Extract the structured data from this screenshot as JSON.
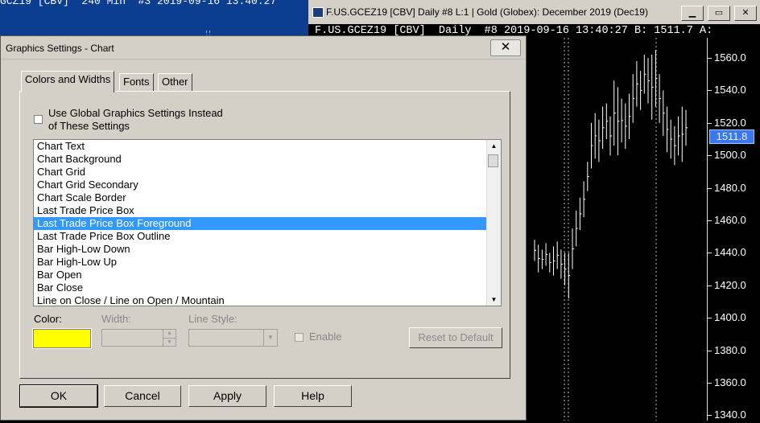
{
  "bg_window": {
    "header": "GCZ19 [CBV]  240 Min  #3 2019-09-16 13:40:27"
  },
  "chart_window": {
    "title": "F.US.GCEZ19 [CBV]  Daily  #8  L:1 | Gold (Globex): December 2019 (Dec19)",
    "info_bar": "F.US.GCEZ19 [CBV]  Daily  #8 2019-09-16 13:40:27 B: 1511.7 A:",
    "price_scale": [
      "1560.0",
      "1540.0",
      "1520.0",
      "1500.0",
      "1480.0",
      "1460.0",
      "1440.0",
      "1420.0",
      "1400.0",
      "1380.0",
      "1360.0",
      "1340.0"
    ],
    "last_price_box": "1511.8",
    "buttons": {
      "minimize": "▁",
      "restore": "▭",
      "close": "✕"
    },
    "colors": {
      "price_box": "#3a78f0",
      "background": "#000000"
    }
  },
  "dialog": {
    "title": "Graphics Settings  - Chart",
    "close_glyph": "✕",
    "tabs": [
      "Colors and Widths",
      "Fonts",
      "Other"
    ],
    "global_checkbox_line1": "Use Global Graphics Settings Instead",
    "global_checkbox_line2": "of These Settings",
    "list_items": [
      "Chart Text",
      "Chart Background",
      "Chart Grid",
      "Chart Grid Secondary",
      "Chart Scale Border",
      "Last Trade Price Box",
      "Last Trade Price Box Foreground",
      "Last Trade Price Box Outline",
      "Bar High-Low Down",
      "Bar High-Low Up",
      "Bar Open",
      "Bar Close",
      "Line on Close / Line on Open / Mountain"
    ],
    "selected_item": "Last Trade Price Box Foreground",
    "color_label": "Color:",
    "width_label": "Width:",
    "line_style_label": "Line Style:",
    "enable_label": "Enable",
    "reset_label": "Reset to Default",
    "ok_label": "OK",
    "cancel_label": "Cancel",
    "apply_label": "Apply",
    "help_label": "Help",
    "selected_color": "#ffff00"
  }
}
